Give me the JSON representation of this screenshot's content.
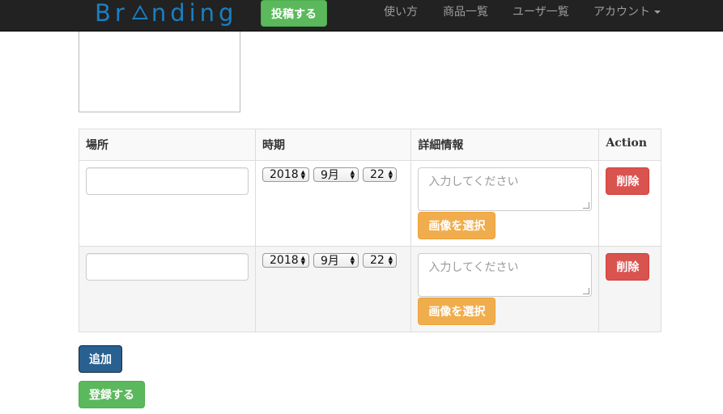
{
  "navbar": {
    "brand_parts": [
      "Br",
      "nding"
    ],
    "post_button": "投稿する",
    "links": [
      "使い方",
      "商品一覧",
      "ユーザ一覧"
    ],
    "account": "アカウント"
  },
  "table": {
    "headers": [
      "場所",
      "時期",
      "詳細情報",
      "Action"
    ],
    "rows": [
      {
        "place": "",
        "year": "2018",
        "month": "9月",
        "day": "22",
        "detail_placeholder": "入力してください",
        "image_button": "画像を選択",
        "delete_button": "削除"
      },
      {
        "place": "",
        "year": "2018",
        "month": "9月",
        "day": "22",
        "detail_placeholder": "入力してください",
        "image_button": "画像を選択",
        "delete_button": "削除"
      }
    ]
  },
  "buttons": {
    "add": "追加",
    "submit": "登録する"
  },
  "icons": {
    "select_arrows": "up-down-arrows-icon",
    "account_caret": "caret-down-icon",
    "brand_triangle": "triangle-a-logo"
  },
  "colors": {
    "brand": "#1a7fc1",
    "success": "#5cb85c",
    "warning": "#f0ad4e",
    "danger": "#d9534f",
    "primary": "#286090"
  }
}
